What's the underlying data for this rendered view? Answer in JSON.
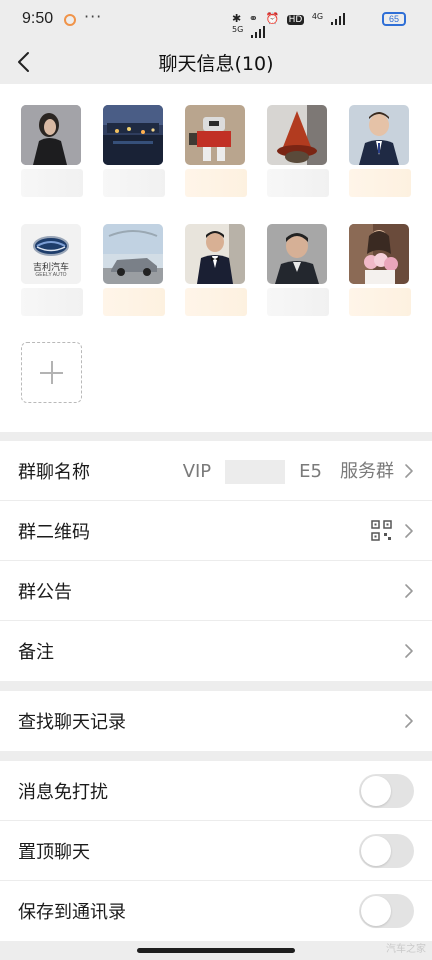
{
  "status": {
    "time": "9:50",
    "more": "···",
    "hd": "HD",
    "net1": "4G",
    "net2": "5G",
    "battery": "65"
  },
  "nav": {
    "title": "聊天信息(10)"
  },
  "members": [
    {
      "name": "",
      "icon": "member-avatar-woman"
    },
    {
      "name": "",
      "icon": "member-avatar-night-city"
    },
    {
      "name": "",
      "icon": "member-avatar-robot-toy"
    },
    {
      "name": "",
      "icon": "member-avatar-witch-hat"
    },
    {
      "name": "",
      "icon": "member-avatar-man-suit"
    },
    {
      "name": "",
      "icon": "member-avatar-geely-logo",
      "logo_text": "吉利汽车",
      "logo_sub": "GEELY AUTO"
    },
    {
      "name": "",
      "icon": "member-avatar-car"
    },
    {
      "name": "",
      "icon": "member-avatar-man-bowtie"
    },
    {
      "name": "",
      "icon": "member-avatar-man-shirt"
    },
    {
      "name": "",
      "icon": "member-avatar-woman-flowers"
    }
  ],
  "settings": {
    "group_name": {
      "label": "群聊名称",
      "value_prefix": "VIP",
      "value_suffix": "E5",
      "value_tail": "服务群"
    },
    "qr": {
      "label": "群二维码"
    },
    "notice": {
      "label": "群公告"
    },
    "remark": {
      "label": "备注"
    },
    "search": {
      "label": "查找聊天记录"
    },
    "mute": {
      "label": "消息免打扰",
      "on": false
    },
    "pin": {
      "label": "置顶聊天",
      "on": false
    },
    "save": {
      "label": "保存到通讯录",
      "on": false
    }
  },
  "watermark": "汽车之家",
  "colors": {
    "background": "#ededed",
    "card": "#ffffff",
    "toggle_off": "#e3e3e3",
    "battery": "#2f6fd6"
  }
}
